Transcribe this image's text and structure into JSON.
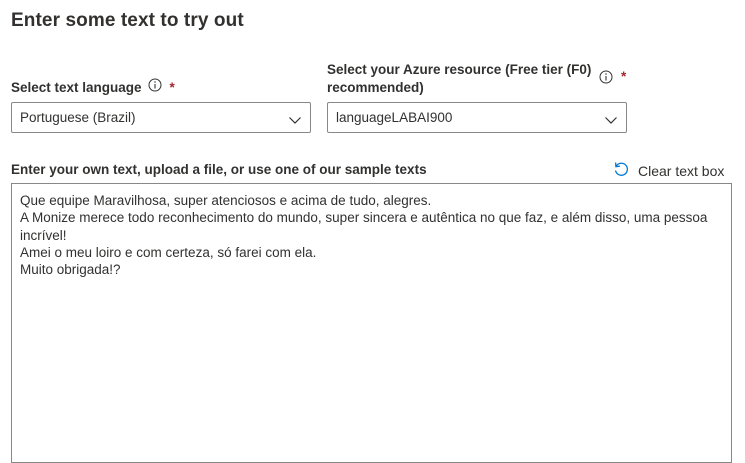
{
  "page": {
    "title": "Enter some text to try out"
  },
  "language": {
    "label": "Select text language",
    "required_mark": "*",
    "selected": "Portuguese (Brazil)"
  },
  "resource": {
    "label": "Select your Azure resource (Free tier (F0) recommended)",
    "required_mark": "*",
    "selected": "languageLABAI900"
  },
  "text_input": {
    "label": "Enter your own text, upload a file, or use one of our sample texts",
    "clear_label": "Clear text box",
    "value": "Que equipe Maravilhosa, super atenciosos e acima de tudo, alegres.\nA Monize merece todo reconhecimento do mundo, super sincera e autêntica no que faz, e além disso, uma pessoa incrível!\nAmei o meu loiro e com certeza, só farei com ela.\nMuito obrigada!?"
  },
  "icons": {
    "info": "info-icon",
    "chevron": "chevron-down-icon",
    "refresh": "refresh-icon"
  },
  "colors": {
    "required": "#a4262c",
    "accent": "#0078d4",
    "border": "#8a8886",
    "text": "#323130"
  }
}
